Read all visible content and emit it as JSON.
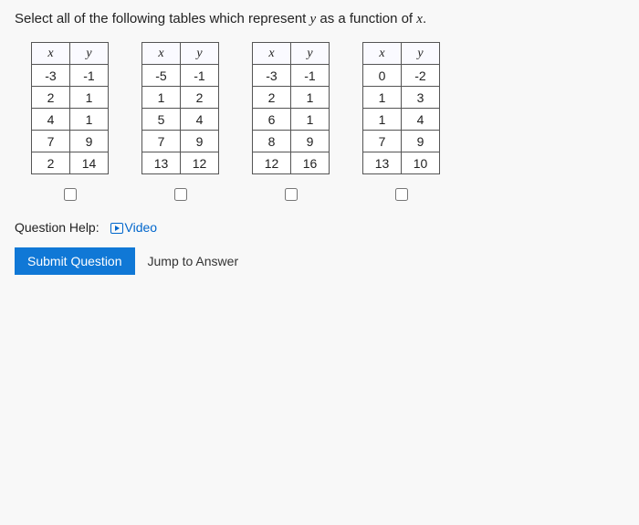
{
  "prompt": {
    "pre": "Select all of the following tables which represent ",
    "var1": "y",
    "mid": " as a function of ",
    "var2": "x",
    "post": "."
  },
  "headers": {
    "x": "x",
    "y": "y"
  },
  "tables": [
    {
      "rows": [
        {
          "x": "-3",
          "y": "-1"
        },
        {
          "x": "2",
          "y": "1"
        },
        {
          "x": "4",
          "y": "1"
        },
        {
          "x": "7",
          "y": "9"
        },
        {
          "x": "2",
          "y": "14"
        }
      ]
    },
    {
      "rows": [
        {
          "x": "-5",
          "y": "-1"
        },
        {
          "x": "1",
          "y": "2"
        },
        {
          "x": "5",
          "y": "4"
        },
        {
          "x": "7",
          "y": "9"
        },
        {
          "x": "13",
          "y": "12"
        }
      ]
    },
    {
      "rows": [
        {
          "x": "-3",
          "y": "-1"
        },
        {
          "x": "2",
          "y": "1"
        },
        {
          "x": "6",
          "y": "1"
        },
        {
          "x": "8",
          "y": "9"
        },
        {
          "x": "12",
          "y": "16"
        }
      ]
    },
    {
      "rows": [
        {
          "x": "0",
          "y": "-2"
        },
        {
          "x": "1",
          "y": "3"
        },
        {
          "x": "1",
          "y": "4"
        },
        {
          "x": "7",
          "y": "9"
        },
        {
          "x": "13",
          "y": "10"
        }
      ]
    }
  ],
  "help": {
    "label": "Question Help:",
    "video": "Video"
  },
  "buttons": {
    "submit": "Submit Question",
    "jump": "Jump to Answer"
  }
}
